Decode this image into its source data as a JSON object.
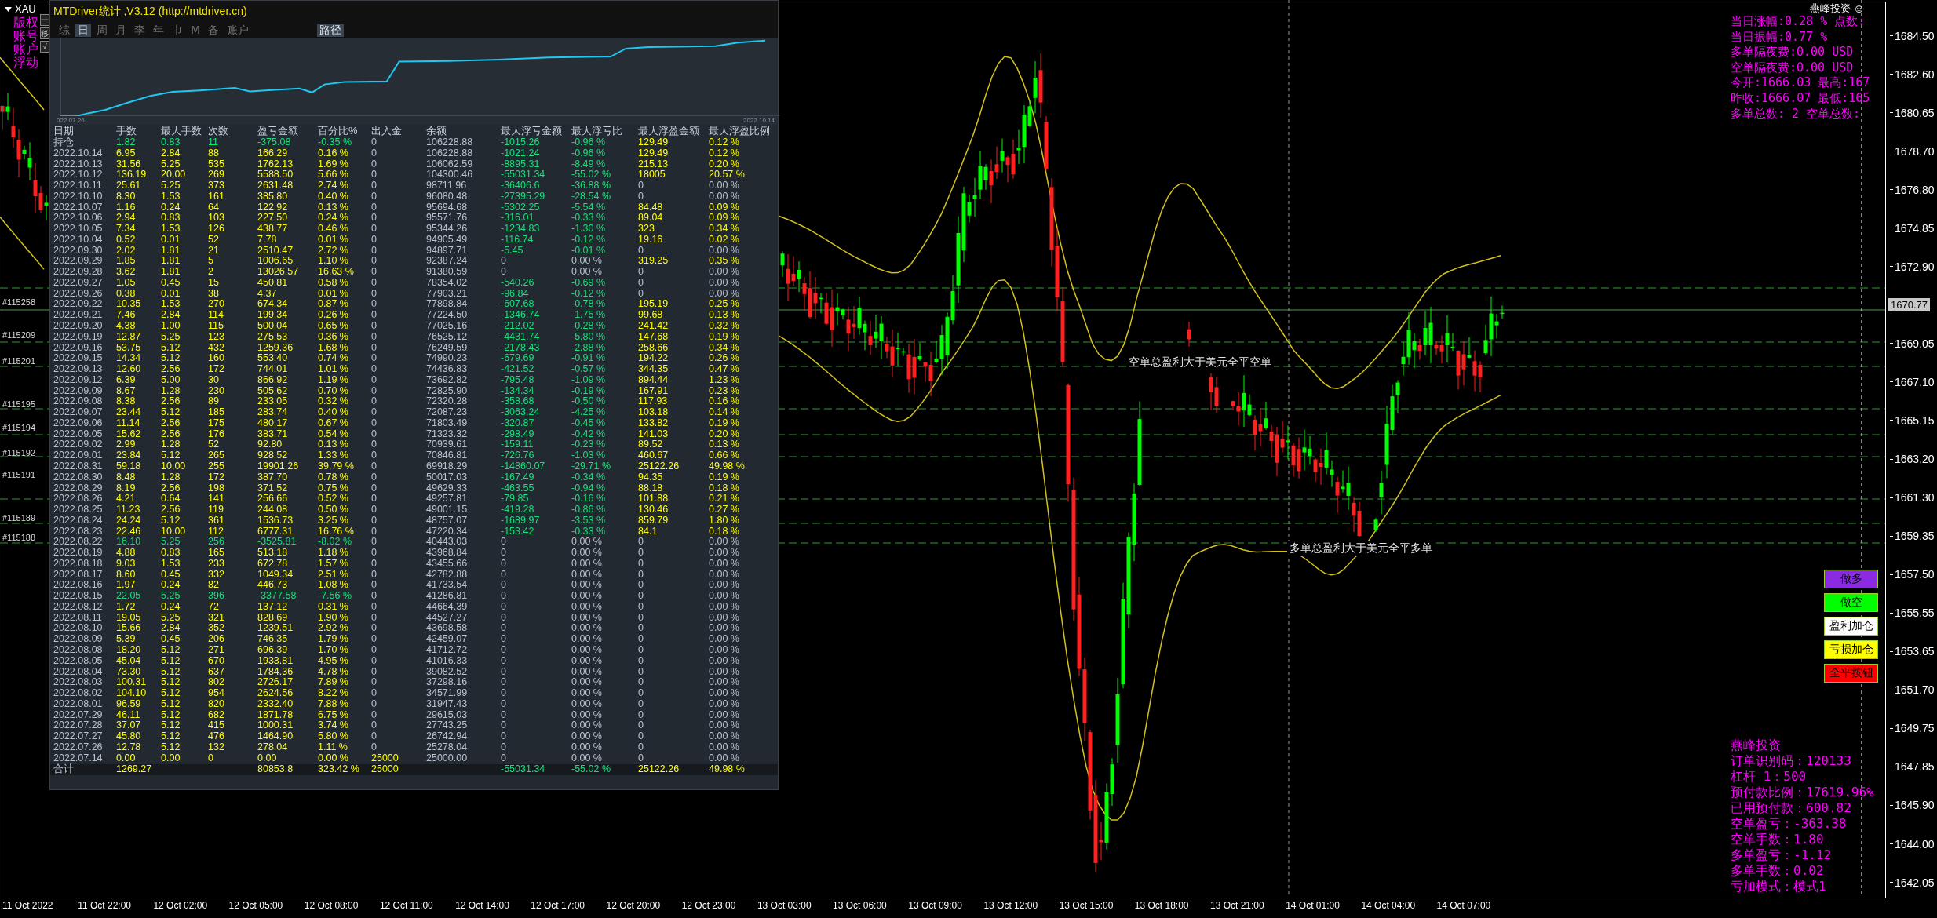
{
  "chart": {
    "symbol": "XAU",
    "corner_labels": [
      "版权",
      "账号",
      "账户",
      "浮动"
    ],
    "order_labels": [
      "#115258",
      "#115209",
      "#115201",
      "#115195",
      "#115194",
      "#115192",
      "#115191",
      "#115189",
      "#115188"
    ],
    "annotations": [
      "空单总盈利大于美元全平空单",
      "多单总盈利大于美元全平多单"
    ],
    "price_axis": [
      {
        "text": "1684.50",
        "kind": "tick"
      },
      {
        "text": "1682.60",
        "kind": "tick"
      },
      {
        "text": "1680.65",
        "kind": "tick"
      },
      {
        "text": "1678.70",
        "kind": "tick"
      },
      {
        "text": "1676.80",
        "kind": "tick"
      },
      {
        "text": "1674.85",
        "kind": "tick"
      },
      {
        "text": "1672.90",
        "kind": "tick"
      },
      {
        "text": "1670.77",
        "kind": "current"
      },
      {
        "text": "1669.05",
        "kind": "tick"
      },
      {
        "text": "1667.10",
        "kind": "tick"
      },
      {
        "text": "1665.15",
        "kind": "tick"
      },
      {
        "text": "1663.20",
        "kind": "tick"
      },
      {
        "text": "1661.30",
        "kind": "tick"
      },
      {
        "text": "1659.35",
        "kind": "tick"
      },
      {
        "text": "1657.50",
        "kind": "tick"
      },
      {
        "text": "1655.55",
        "kind": "tick"
      },
      {
        "text": "1653.65",
        "kind": "tick"
      },
      {
        "text": "1651.70",
        "kind": "tick"
      },
      {
        "text": "1649.75",
        "kind": "tick"
      },
      {
        "text": "1647.85",
        "kind": "tick"
      },
      {
        "text": "1645.90",
        "kind": "tick"
      },
      {
        "text": "1644.00",
        "kind": "tick"
      },
      {
        "text": "1642.05",
        "kind": "tick"
      }
    ],
    "time_axis": [
      "11 Oct 2022",
      "11 Oct 22:00",
      "12 Oct 02:00",
      "12 Oct 05:00",
      "12 Oct 08:00",
      "12 Oct 11:00",
      "12 Oct 14:00",
      "12 Oct 17:00",
      "12 Oct 20:00",
      "12 Oct 23:00",
      "13 Oct 03:00",
      "13 Oct 06:00",
      "13 Oct 09:00",
      "13 Oct 12:00",
      "13 Oct 15:00",
      "13 Oct 18:00",
      "13 Oct 21:00",
      "14 Oct 01:00",
      "14 Oct 04:00",
      "14 Oct 07:00"
    ]
  },
  "stats_window": {
    "title": "MTDriver统计 ,V3.12 (http://mtdriver.cn)",
    "side_buttons": [
      "一",
      "移",
      "√"
    ],
    "tabs": [
      {
        "label": "综",
        "selected": false
      },
      {
        "label": "日",
        "selected": true
      },
      {
        "label": "周",
        "selected": false
      },
      {
        "label": "月",
        "selected": false
      },
      {
        "label": "李",
        "selected": false
      },
      {
        "label": "年",
        "selected": false
      },
      {
        "label": "巾",
        "selected": false
      },
      {
        "label": "M",
        "selected": false
      },
      {
        "label": "备",
        "selected": false
      },
      {
        "label": "账户",
        "selected": false
      }
    ],
    "path_button": "路径",
    "curve": {
      "start_label": "022.07.26",
      "end_label": "2022.10.14"
    },
    "columns": [
      "日期",
      "手数",
      "最大手数",
      "次数",
      "盈亏金额",
      "百分比%",
      "出入金",
      "余额",
      "最大浮亏金额",
      "最大浮亏比",
      "最大浮盈金额",
      "最大浮盈比例"
    ],
    "rows": [
      {
        "cells": [
          "持仓",
          "1.82",
          "0.83",
          "11",
          "-375.08",
          "-0.35 %",
          "0",
          "106228.88",
          "-1015.26",
          "-0.96 %",
          "129.49",
          "0.12 %"
        ],
        "loss": true,
        "deposit": false,
        "float_loss": true,
        "float_gain": true
      },
      {
        "cells": [
          "2022.10.14",
          "6.95",
          "2.84",
          "88",
          "166.29",
          "0.16 %",
          "0",
          "106228.88",
          "-1021.24",
          "-0.96 %",
          "129.49",
          "0.12 %"
        ],
        "loss": false,
        "deposit": false,
        "float_loss": true,
        "float_gain": true
      },
      {
        "cells": [
          "2022.10.13",
          "31.56",
          "5.25",
          "535",
          "1762.13",
          "1.69 %",
          "0",
          "106062.59",
          "-8895.31",
          "-8.49 %",
          "215.13",
          "0.20 %"
        ],
        "loss": false,
        "deposit": false,
        "float_loss": true,
        "float_gain": true
      },
      {
        "cells": [
          "2022.10.12",
          "136.19",
          "20.00",
          "269",
          "5588.50",
          "5.66 %",
          "0",
          "104300.46",
          "-55031.34",
          "-55.02 %",
          "18005",
          "20.57 %"
        ],
        "loss": false,
        "deposit": false,
        "float_loss": true,
        "float_gain": true
      },
      {
        "cells": [
          "2022.10.11",
          "25.61",
          "5.25",
          "373",
          "2631.48",
          "2.74 %",
          "0",
          "98711.96",
          "-36406.6",
          "-36.88 %",
          "0",
          "0.00 %"
        ],
        "loss": false,
        "deposit": false,
        "float_loss": true,
        "float_gain": false
      },
      {
        "cells": [
          "2022.10.10",
          "8.30",
          "1.53",
          "161",
          "385.80",
          "0.40 %",
          "0",
          "96080.48",
          "-27395.29",
          "-28.54 %",
          "0",
          "0.00 %"
        ],
        "loss": false,
        "deposit": false,
        "float_loss": true,
        "float_gain": false
      },
      {
        "cells": [
          "2022.10.07",
          "1.16",
          "0.24",
          "64",
          "122.92",
          "0.13 %",
          "0",
          "95694.68",
          "-5302.25",
          "-5.54 %",
          "84.48",
          "0.09 %"
        ],
        "loss": false,
        "deposit": false,
        "float_loss": true,
        "float_gain": true
      },
      {
        "cells": [
          "2022.10.06",
          "2.94",
          "0.83",
          "103",
          "227.50",
          "0.24 %",
          "0",
          "95571.76",
          "-316.01",
          "-0.33 %",
          "89.04",
          "0.09 %"
        ],
        "loss": false,
        "deposit": false,
        "float_loss": true,
        "float_gain": true
      },
      {
        "cells": [
          "2022.10.05",
          "7.34",
          "1.53",
          "126",
          "438.77",
          "0.46 %",
          "0",
          "95344.26",
          "-1234.83",
          "-1.30 %",
          "323",
          "0.34 %"
        ],
        "loss": false,
        "deposit": false,
        "float_loss": true,
        "float_gain": true
      },
      {
        "cells": [
          "2022.10.04",
          "0.52",
          "0.01",
          "52",
          "7.78",
          "0.01 %",
          "0",
          "94905.49",
          "-116.74",
          "-0.12 %",
          "19.16",
          "0.02 %"
        ],
        "loss": false,
        "deposit": false,
        "float_loss": true,
        "float_gain": true
      },
      {
        "cells": [
          "2022.09.30",
          "2.02",
          "1.81",
          "21",
          "2510.47",
          "2.72 %",
          "0",
          "94897.71",
          "-5.45",
          "-0.01 %",
          "0",
          "0.00 %"
        ],
        "loss": false,
        "deposit": false,
        "float_loss": true,
        "float_gain": false
      },
      {
        "cells": [
          "2022.09.29",
          "1.85",
          "1.81",
          "5",
          "1006.65",
          "1.10 %",
          "0",
          "92387.24",
          "0",
          "0.00 %",
          "319.25",
          "0.35 %"
        ],
        "loss": false,
        "deposit": false,
        "float_loss": false,
        "float_gain": true
      },
      {
        "cells": [
          "2022.09.28",
          "3.62",
          "1.81",
          "2",
          "13026.57",
          "16.63 %",
          "0",
          "91380.59",
          "0",
          "0.00 %",
          "0",
          "0.00 %"
        ],
        "loss": false,
        "deposit": false,
        "float_loss": false,
        "float_gain": false
      },
      {
        "cells": [
          "2022.09.27",
          "1.05",
          "0.45",
          "15",
          "450.81",
          "0.58 %",
          "0",
          "78354.02",
          "-540.26",
          "-0.69 %",
          "0",
          "0.00 %"
        ],
        "loss": false,
        "deposit": false,
        "float_loss": true,
        "float_gain": false
      },
      {
        "cells": [
          "2022.09.26",
          "0.38",
          "0.01",
          "38",
          "4.37",
          "0.01 %",
          "0",
          "77903.21",
          "-96.84",
          "-0.12 %",
          "0",
          "0.00 %"
        ],
        "loss": false,
        "deposit": false,
        "float_loss": true,
        "float_gain": false
      },
      {
        "cells": [
          "2022.09.22",
          "10.35",
          "1.53",
          "270",
          "674.34",
          "0.87 %",
          "0",
          "77898.84",
          "-607.68",
          "-0.78 %",
          "195.19",
          "0.25 %"
        ],
        "loss": false,
        "deposit": false,
        "float_loss": true,
        "float_gain": true
      },
      {
        "cells": [
          "2022.09.21",
          "7.46",
          "2.84",
          "114",
          "199.34",
          "0.26 %",
          "0",
          "77224.50",
          "-1346.74",
          "-1.75 %",
          "99.68",
          "0.13 %"
        ],
        "loss": false,
        "deposit": false,
        "float_loss": true,
        "float_gain": true
      },
      {
        "cells": [
          "2022.09.20",
          "4.38",
          "1.00",
          "115",
          "500.04",
          "0.65 %",
          "0",
          "77025.16",
          "-212.02",
          "-0.28 %",
          "241.42",
          "0.32 %"
        ],
        "loss": false,
        "deposit": false,
        "float_loss": true,
        "float_gain": true
      },
      {
        "cells": [
          "2022.09.19",
          "12.87",
          "5.25",
          "123",
          "275.53",
          "0.36 %",
          "0",
          "76525.12",
          "-4431.74",
          "-5.80 %",
          "147.68",
          "0.19 %"
        ],
        "loss": false,
        "deposit": false,
        "float_loss": true,
        "float_gain": true
      },
      {
        "cells": [
          "2022.09.16",
          "53.75",
          "5.12",
          "432",
          "1259.36",
          "1.68 %",
          "0",
          "76249.59",
          "-2178.43",
          "-2.88 %",
          "258.66",
          "0.34 %"
        ],
        "loss": false,
        "deposit": false,
        "float_loss": true,
        "float_gain": true
      },
      {
        "cells": [
          "2022.09.15",
          "14.34",
          "5.12",
          "160",
          "553.40",
          "0.74 %",
          "0",
          "74990.23",
          "-679.69",
          "-0.91 %",
          "194.22",
          "0.26 %"
        ],
        "loss": false,
        "deposit": false,
        "float_loss": true,
        "float_gain": true
      },
      {
        "cells": [
          "2022.09.13",
          "12.60",
          "2.56",
          "172",
          "744.01",
          "1.01 %",
          "0",
          "74436.83",
          "-421.52",
          "-0.57 %",
          "344.35",
          "0.47 %"
        ],
        "loss": false,
        "deposit": false,
        "float_loss": true,
        "float_gain": true
      },
      {
        "cells": [
          "2022.09.12",
          "6.39",
          "5.00",
          "30",
          "866.92",
          "1.19 %",
          "0",
          "73692.82",
          "-795.48",
          "-1.09 %",
          "894.44",
          "1.23 %"
        ],
        "loss": false,
        "deposit": false,
        "float_loss": true,
        "float_gain": true
      },
      {
        "cells": [
          "2022.09.09",
          "8.67",
          "1.28",
          "230",
          "505.62",
          "0.70 %",
          "0",
          "72825.90",
          "-134.34",
          "-0.19 %",
          "167.91",
          "0.23 %"
        ],
        "loss": false,
        "deposit": false,
        "float_loss": true,
        "float_gain": true
      },
      {
        "cells": [
          "2022.09.08",
          "8.38",
          "2.56",
          "89",
          "233.05",
          "0.32 %",
          "0",
          "72320.28",
          "-358.68",
          "-0.50 %",
          "117.93",
          "0.16 %"
        ],
        "loss": false,
        "deposit": false,
        "float_loss": true,
        "float_gain": true
      },
      {
        "cells": [
          "2022.09.07",
          "23.44",
          "5.12",
          "185",
          "283.74",
          "0.40 %",
          "0",
          "72087.23",
          "-3063.24",
          "-4.25 %",
          "103.18",
          "0.14 %"
        ],
        "loss": false,
        "deposit": false,
        "float_loss": true,
        "float_gain": true
      },
      {
        "cells": [
          "2022.09.06",
          "11.14",
          "2.56",
          "175",
          "480.17",
          "0.67 %",
          "0",
          "71803.49",
          "-320.87",
          "-0.45 %",
          "133.82",
          "0.19 %"
        ],
        "loss": false,
        "deposit": false,
        "float_loss": true,
        "float_gain": true
      },
      {
        "cells": [
          "2022.09.05",
          "15.62",
          "2.56",
          "176",
          "383.71",
          "0.54 %",
          "0",
          "71323.32",
          "-298.49",
          "-0.42 %",
          "141.03",
          "0.20 %"
        ],
        "loss": false,
        "deposit": false,
        "float_loss": true,
        "float_gain": true
      },
      {
        "cells": [
          "2022.09.02",
          "2.99",
          "1.28",
          "52",
          "92.80",
          "0.13 %",
          "0",
          "70939.61",
          "-159.11",
          "-0.23 %",
          "89.52",
          "0.13 %"
        ],
        "loss": false,
        "deposit": false,
        "float_loss": true,
        "float_gain": true
      },
      {
        "cells": [
          "2022.09.01",
          "23.84",
          "5.12",
          "265",
          "928.52",
          "1.33 %",
          "0",
          "70846.81",
          "-726.76",
          "-1.03 %",
          "460.67",
          "0.66 %"
        ],
        "loss": false,
        "deposit": false,
        "float_loss": true,
        "float_gain": true
      },
      {
        "cells": [
          "2022.08.31",
          "59.18",
          "10.00",
          "255",
          "19901.26",
          "39.79 %",
          "0",
          "69918.29",
          "-14860.07",
          "-29.71 %",
          "25122.26",
          "49.98 %"
        ],
        "loss": false,
        "deposit": false,
        "float_loss": true,
        "float_gain": true
      },
      {
        "cells": [
          "2022.08.30",
          "8.48",
          "1.28",
          "172",
          "387.70",
          "0.78 %",
          "0",
          "50017.03",
          "-167.49",
          "-0.34 %",
          "94.35",
          "0.19 %"
        ],
        "loss": false,
        "deposit": false,
        "float_loss": true,
        "float_gain": true
      },
      {
        "cells": [
          "2022.08.29",
          "8.19",
          "2.56",
          "198",
          "371.52",
          "0.75 %",
          "0",
          "49629.33",
          "-463.55",
          "-0.94 %",
          "88.18",
          "0.18 %"
        ],
        "loss": false,
        "deposit": false,
        "float_loss": true,
        "float_gain": true
      },
      {
        "cells": [
          "2022.08.26",
          "4.21",
          "0.64",
          "141",
          "256.66",
          "0.52 %",
          "0",
          "49257.81",
          "-79.85",
          "-0.16 %",
          "101.88",
          "0.21 %"
        ],
        "loss": false,
        "deposit": false,
        "float_loss": true,
        "float_gain": true
      },
      {
        "cells": [
          "2022.08.25",
          "11.23",
          "2.56",
          "119",
          "244.08",
          "0.50 %",
          "0",
          "49001.15",
          "-419.28",
          "-0.86 %",
          "130.46",
          "0.27 %"
        ],
        "loss": false,
        "deposit": false,
        "float_loss": true,
        "float_gain": true
      },
      {
        "cells": [
          "2022.08.24",
          "24.24",
          "5.12",
          "361",
          "1536.73",
          "3.25 %",
          "0",
          "48757.07",
          "-1689.97",
          "-3.53 %",
          "859.79",
          "1.80 %"
        ],
        "loss": false,
        "deposit": false,
        "float_loss": true,
        "float_gain": true
      },
      {
        "cells": [
          "2022.08.23",
          "22.46",
          "10.00",
          "112",
          "6777.31",
          "16.76 %",
          "0",
          "47220.34",
          "-153.42",
          "-0.33 %",
          "84.1",
          "0.18 %"
        ],
        "loss": false,
        "deposit": false,
        "float_loss": true,
        "float_gain": true
      },
      {
        "cells": [
          "2022.08.22",
          "16.10",
          "5.25",
          "256",
          "-3525.81",
          "-8.02 %",
          "0",
          "40443.03",
          "0",
          "0.00 %",
          "0",
          "0.00 %"
        ],
        "loss": true,
        "deposit": false,
        "float_loss": false,
        "float_gain": false
      },
      {
        "cells": [
          "2022.08.19",
          "4.88",
          "0.83",
          "165",
          "513.18",
          "1.18 %",
          "0",
          "43968.84",
          "0",
          "0.00 %",
          "0",
          "0.00 %"
        ],
        "loss": false,
        "deposit": false,
        "float_loss": false,
        "float_gain": false
      },
      {
        "cells": [
          "2022.08.18",
          "9.03",
          "1.53",
          "233",
          "672.78",
          "1.57 %",
          "0",
          "43455.66",
          "0",
          "0.00 %",
          "0",
          "0.00 %"
        ],
        "loss": false,
        "deposit": false,
        "float_loss": false,
        "float_gain": false
      },
      {
        "cells": [
          "2022.08.17",
          "8.60",
          "0.45",
          "332",
          "1049.34",
          "2.51 %",
          "0",
          "42782.88",
          "0",
          "0.00 %",
          "0",
          "0.00 %"
        ],
        "loss": false,
        "deposit": false,
        "float_loss": false,
        "float_gain": false
      },
      {
        "cells": [
          "2022.08.16",
          "1.97",
          "0.24",
          "82",
          "446.73",
          "1.08 %",
          "0",
          "41733.54",
          "0",
          "0.00 %",
          "0",
          "0.00 %"
        ],
        "loss": false,
        "deposit": false,
        "float_loss": false,
        "float_gain": false
      },
      {
        "cells": [
          "2022.08.15",
          "22.05",
          "5.25",
          "396",
          "-3377.58",
          "-7.56 %",
          "0",
          "41286.81",
          "0",
          "0.00 %",
          "0",
          "0.00 %"
        ],
        "loss": true,
        "deposit": false,
        "float_loss": false,
        "float_gain": false
      },
      {
        "cells": [
          "2022.08.12",
          "1.72",
          "0.24",
          "72",
          "137.12",
          "0.31 %",
          "0",
          "44664.39",
          "0",
          "0.00 %",
          "0",
          "0.00 %"
        ],
        "loss": false,
        "deposit": false,
        "float_loss": false,
        "float_gain": false
      },
      {
        "cells": [
          "2022.08.11",
          "19.05",
          "5.25",
          "321",
          "828.69",
          "1.90 %",
          "0",
          "44527.27",
          "0",
          "0.00 %",
          "0",
          "0.00 %"
        ],
        "loss": false,
        "deposit": false,
        "float_loss": false,
        "float_gain": false
      },
      {
        "cells": [
          "2022.08.10",
          "15.66",
          "2.84",
          "352",
          "1239.51",
          "2.92 %",
          "0",
          "43698.58",
          "0",
          "0.00 %",
          "0",
          "0.00 %"
        ],
        "loss": false,
        "deposit": false,
        "float_loss": false,
        "float_gain": false
      },
      {
        "cells": [
          "2022.08.09",
          "5.39",
          "0.45",
          "206",
          "746.35",
          "1.79 %",
          "0",
          "42459.07",
          "0",
          "0.00 %",
          "0",
          "0.00 %"
        ],
        "loss": false,
        "deposit": false,
        "float_loss": false,
        "float_gain": false
      },
      {
        "cells": [
          "2022.08.08",
          "18.20",
          "5.12",
          "271",
          "696.39",
          "1.70 %",
          "0",
          "41712.72",
          "0",
          "0.00 %",
          "0",
          "0.00 %"
        ],
        "loss": false,
        "deposit": false,
        "float_loss": false,
        "float_gain": false
      },
      {
        "cells": [
          "2022.08.05",
          "45.04",
          "5.12",
          "670",
          "1933.81",
          "4.95 %",
          "0",
          "41016.33",
          "0",
          "0.00 %",
          "0",
          "0.00 %"
        ],
        "loss": false,
        "deposit": false,
        "float_loss": false,
        "float_gain": false
      },
      {
        "cells": [
          "2022.08.04",
          "73.30",
          "5.12",
          "637",
          "1784.36",
          "4.78 %",
          "0",
          "39082.52",
          "0",
          "0.00 %",
          "0",
          "0.00 %"
        ],
        "loss": false,
        "deposit": false,
        "float_loss": false,
        "float_gain": false
      },
      {
        "cells": [
          "2022.08.03",
          "100.31",
          "5.12",
          "802",
          "2726.17",
          "7.89 %",
          "0",
          "37298.16",
          "0",
          "0.00 %",
          "0",
          "0.00 %"
        ],
        "loss": false,
        "deposit": false,
        "float_loss": false,
        "float_gain": false
      },
      {
        "cells": [
          "2022.08.02",
          "104.10",
          "5.12",
          "954",
          "2624.56",
          "8.22 %",
          "0",
          "34571.99",
          "0",
          "0.00 %",
          "0",
          "0.00 %"
        ],
        "loss": false,
        "deposit": false,
        "float_loss": false,
        "float_gain": false
      },
      {
        "cells": [
          "2022.08.01",
          "96.59",
          "5.12",
          "820",
          "2332.40",
          "7.88 %",
          "0",
          "31947.43",
          "0",
          "0.00 %",
          "0",
          "0.00 %"
        ],
        "loss": false,
        "deposit": false,
        "float_loss": false,
        "float_gain": false
      },
      {
        "cells": [
          "2022.07.29",
          "46.11",
          "5.12",
          "682",
          "1871.78",
          "6.75 %",
          "0",
          "29615.03",
          "0",
          "0.00 %",
          "0",
          "0.00 %"
        ],
        "loss": false,
        "deposit": false,
        "float_loss": false,
        "float_gain": false
      },
      {
        "cells": [
          "2022.07.28",
          "37.07",
          "5.12",
          "415",
          "1000.31",
          "3.74 %",
          "0",
          "27743.25",
          "0",
          "0.00 %",
          "0",
          "0.00 %"
        ],
        "loss": false,
        "deposit": false,
        "float_loss": false,
        "float_gain": false
      },
      {
        "cells": [
          "2022.07.27",
          "45.80",
          "5.12",
          "476",
          "1464.90",
          "5.80 %",
          "0",
          "26742.94",
          "0",
          "0.00 %",
          "0",
          "0.00 %"
        ],
        "loss": false,
        "deposit": false,
        "float_loss": false,
        "float_gain": false
      },
      {
        "cells": [
          "2022.07.26",
          "12.78",
          "5.12",
          "132",
          "278.04",
          "1.11 %",
          "0",
          "25278.04",
          "0",
          "0.00 %",
          "0",
          "0.00 %"
        ],
        "loss": false,
        "deposit": false,
        "float_loss": false,
        "float_gain": false
      },
      {
        "cells": [
          "2022.07.14",
          "0.00",
          "0.00",
          "0",
          "0.00",
          "0.00 %",
          "25000",
          "25000.00",
          "0",
          "0.00 %",
          "0",
          "0.00 %"
        ],
        "loss": false,
        "deposit": true,
        "float_loss": false,
        "float_gain": false
      }
    ],
    "totals": {
      "label": "合计",
      "lots": "1269.27",
      "profit": "80853.8",
      "percent": "323.42 %",
      "deposit": "25000",
      "max_float_loss": "-55031.34",
      "max_float_loss_pct": "-55.02 %",
      "max_float_gain": "25122.26",
      "max_float_gain_pct": "49.98 %"
    }
  },
  "info_panel": {
    "brand": "燕峰投资",
    "brand_icon": "☺",
    "lines": [
      "当日涨幅:0.28 % 点数:",
      "当日振幅:0.77 %",
      "多单隔夜费:0.00 USD",
      "空单隔夜费:0.00 USD",
      "今开:1666.03  最高:167",
      "昨收:1666.07  最低:165",
      "多单总数: 2 空单总数:"
    ]
  },
  "trade_buttons": [
    {
      "label": "做多",
      "color": "#8a2be2"
    },
    {
      "label": "做空",
      "color": "#00ff00"
    },
    {
      "label": "盈利加仓",
      "color": "#ffffff"
    },
    {
      "label": "亏损加仓",
      "color": "#ffff00"
    },
    {
      "label": "全平按钮",
      "color": "#ff0000"
    }
  ],
  "account_panel": {
    "lines": [
      "燕峰投资",
      "订单识别码：120133",
      "杠杆 1：500",
      "预付款比例：17619.96%",
      "已用预付款：600.82",
      "空单盈亏：-363.38",
      "空单手数：1.80",
      "多单盈亏：-1.12",
      "多单手数：0.02",
      "亏加模式：模式1"
    ]
  }
}
